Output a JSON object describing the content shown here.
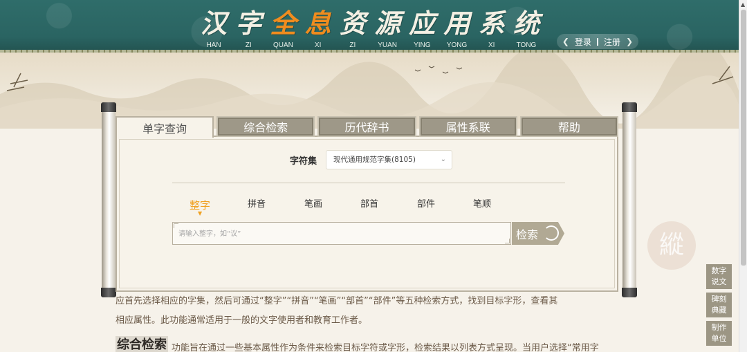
{
  "header": {
    "title_chars": [
      "汉",
      "字",
      "全",
      "息",
      "资",
      "源",
      "应",
      "用",
      "系",
      "统"
    ],
    "highlight_indices": [
      2,
      3
    ],
    "pinyin": [
      "HAN",
      "ZI",
      "QUAN",
      "XI",
      "ZI",
      "YUAN",
      "YING",
      "YONG",
      "XI",
      "TONG"
    ],
    "login_label": "登录",
    "register_label": "注册",
    "colors": {
      "banner": "#2a6462",
      "highlight": "#f08c1e",
      "title": "#f4f0e4"
    }
  },
  "tabs": [
    {
      "label": "单字查询",
      "active": true
    },
    {
      "label": "综合检索",
      "active": false
    },
    {
      "label": "历代辞书",
      "active": false
    },
    {
      "label": "属性系联",
      "active": false
    },
    {
      "label": "帮助",
      "active": false
    }
  ],
  "charset": {
    "label": "字符集",
    "selected": "现代通用规范字集(8105)"
  },
  "modes": [
    {
      "label": "整字",
      "active": true
    },
    {
      "label": "拼音",
      "active": false
    },
    {
      "label": "笔画",
      "active": false
    },
    {
      "label": "部首",
      "active": false
    },
    {
      "label": "部件",
      "active": false
    },
    {
      "label": "笔顺",
      "active": false
    }
  ],
  "search": {
    "placeholder": "请输入整字，如“议”",
    "button_label": "检索"
  },
  "help": {
    "line1": "应首先选择相应的字集，然后可通过“整字”“拼音”“笔画”“部首”“部件”等五种检索方式，找到目标字形，查看其",
    "line2": "相应属性。此功能通常适用于一般的文字使用者和教育工作者。",
    "section_title": "综合检索",
    "section_text": "功能旨在通过一些基本属性作为条件来检索目标字符或字形，检索结果以列表方式呈现。当用户选择“常用字"
  },
  "side_buttons": [
    {
      "line1": "数字",
      "line2": "说文"
    },
    {
      "line1": "碑刻",
      "line2": "典藏"
    },
    {
      "line1": "制作",
      "line2": "单位"
    }
  ],
  "badge_char": "縱"
}
